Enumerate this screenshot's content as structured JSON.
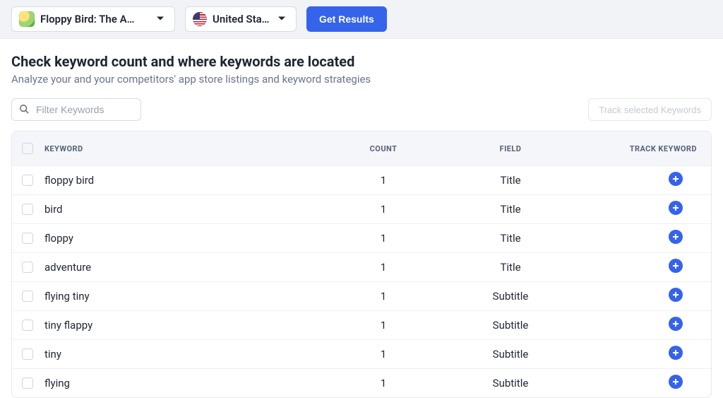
{
  "header": {
    "app_selector_label": "Floppy Bird: The Adventu",
    "country_selector_label": "United States",
    "get_results_label": "Get Results"
  },
  "page": {
    "title": "Check keyword count and where keywords are located",
    "subtitle": "Analyze your and your competitors' app store listings and keyword strategies"
  },
  "toolbar": {
    "filter_placeholder": "Filter Keywords",
    "track_selected_label": "Track selected Keywords"
  },
  "table": {
    "columns": {
      "keyword": "Keyword",
      "count": "Count",
      "field": "Field",
      "track": "Track Keyword"
    },
    "rows": [
      {
        "keyword": "floppy bird",
        "count": "1",
        "field": "Title"
      },
      {
        "keyword": "bird",
        "count": "1",
        "field": "Title"
      },
      {
        "keyword": "floppy",
        "count": "1",
        "field": "Title"
      },
      {
        "keyword": "adventure",
        "count": "1",
        "field": "Title"
      },
      {
        "keyword": "flying tiny",
        "count": "1",
        "field": "Subtitle"
      },
      {
        "keyword": "tiny flappy",
        "count": "1",
        "field": "Subtitle"
      },
      {
        "keyword": "tiny",
        "count": "1",
        "field": "Subtitle"
      },
      {
        "keyword": "flying",
        "count": "1",
        "field": "Subtitle"
      }
    ]
  }
}
